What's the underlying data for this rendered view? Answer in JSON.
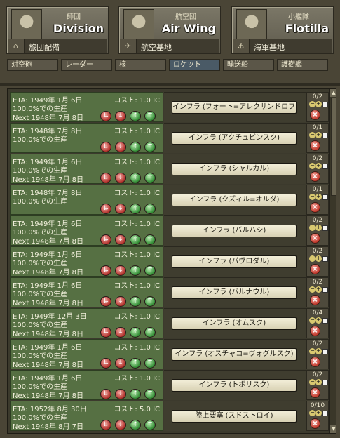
{
  "tiles": [
    {
      "small": "師団",
      "big": "Division",
      "bottom": "旅団配備"
    },
    {
      "small": "航空団",
      "big": "Air Wing",
      "bottom": "航空基地"
    },
    {
      "small": "小艦隊",
      "big": "Flotilla",
      "bottom": "海軍基地"
    }
  ],
  "tabs": [
    "対空砲",
    "レーダー",
    "核",
    "ロケット",
    "輸送船",
    "護衛艦"
  ],
  "rows": [
    {
      "eta": "ETA: 1949年 1月 6日",
      "cost": "コスト: 1.0 IC",
      "prod": "100.0%での生産",
      "next": "Next 1948年 7月 8日",
      "name": "インフラ (フォート=アレクサンドロフスキー)",
      "count": "0/2"
    },
    {
      "eta": "ETA: 1948年 7月 8日",
      "cost": "コスト: 1.0 IC",
      "prod": "100.0%での生産",
      "next": "",
      "name": "インフラ (アクチュビンスク)",
      "count": "0/1"
    },
    {
      "eta": "ETA: 1949年 1月 6日",
      "cost": "コスト: 1.0 IC",
      "prod": "100.0%での生産",
      "next": "Next 1948年 7月 8日",
      "name": "インフラ (シャルカル)",
      "count": "0/2"
    },
    {
      "eta": "ETA: 1948年 7月 8日",
      "cost": "コスト: 1.0 IC",
      "prod": "100.0%での生産",
      "next": "",
      "name": "インフラ (クズィル=オルダ)",
      "count": "0/1"
    },
    {
      "eta": "ETA: 1949年 1月 6日",
      "cost": "コスト: 1.0 IC",
      "prod": "100.0%での生産",
      "next": "Next 1948年 7月 8日",
      "name": "インフラ (バルハシ)",
      "count": "0/2"
    },
    {
      "eta": "ETA: 1949年 1月 6日",
      "cost": "コスト: 1.0 IC",
      "prod": "100.0%での生産",
      "next": "Next 1948年 7月 8日",
      "name": "インフラ (パヴロダル)",
      "count": "0/2"
    },
    {
      "eta": "ETA: 1949年 1月 6日",
      "cost": "コスト: 1.0 IC",
      "prod": "100.0%での生産",
      "next": "Next 1948年 7月 8日",
      "name": "インフラ (バルナウル)",
      "count": "0/2"
    },
    {
      "eta": "ETA: 1949年 12月 3日",
      "cost": "コスト: 1.0 IC",
      "prod": "100.0%での生産",
      "next": "Next 1948年 7月 8日",
      "name": "インフラ (オムスク)",
      "count": "0/4"
    },
    {
      "eta": "ETA: 1949年 1月 6日",
      "cost": "コスト: 1.0 IC",
      "prod": "100.0%での生産",
      "next": "Next 1948年 7月 8日",
      "name": "インフラ (オスチャコ=ヴォグルスク)",
      "count": "0/2"
    },
    {
      "eta": "ETA: 1949年 1月 6日",
      "cost": "コスト: 1.0 IC",
      "prod": "100.0%での生産",
      "next": "Next 1948年 7月 8日",
      "name": "インフラ (トボリスク)",
      "count": "0/2"
    },
    {
      "eta": "ETA: 1952年 8月 30日",
      "cost": "コスト: 5.0 IC",
      "prod": "100.0%での生産",
      "next": "Next 1948年 8月 7日",
      "name": "陸上要塞 (スドストロイ)",
      "count": "0/10"
    }
  ]
}
